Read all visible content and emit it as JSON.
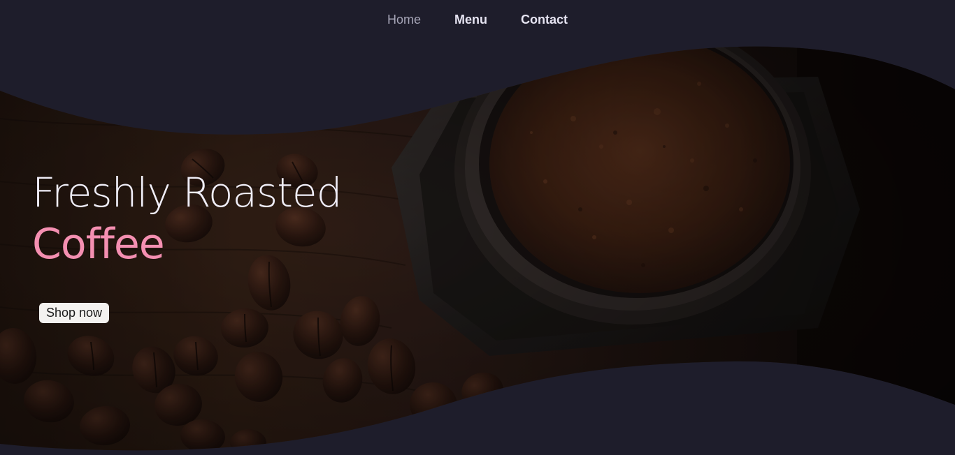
{
  "nav": {
    "items": [
      {
        "label": "Home"
      },
      {
        "label": "Menu"
      },
      {
        "label": "Contact"
      }
    ]
  },
  "hero": {
    "headline_line1": "Freshly Roasted",
    "headline_line2": "Coffee",
    "cta_label": "Shop now"
  },
  "colors": {
    "background": "#1e1d2b",
    "accent_pink": "#f48fb1",
    "nav_text": "#e6e4f2",
    "nav_text_dim": "#a7a6b8",
    "button_bg": "#f4f2f0"
  }
}
